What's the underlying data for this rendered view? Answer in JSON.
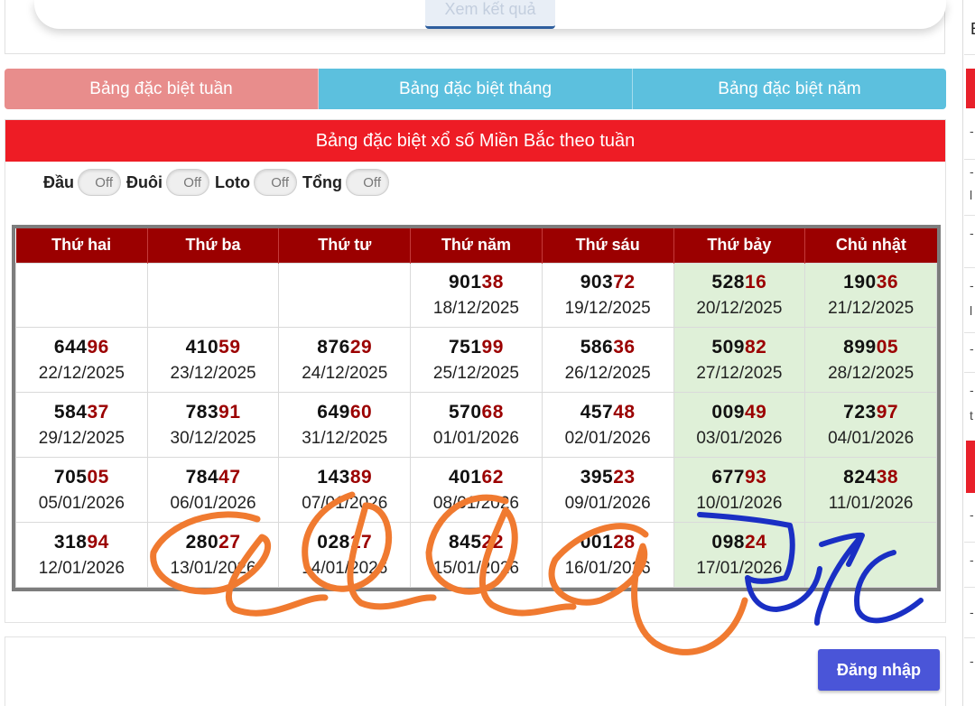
{
  "top": {
    "view_button": "Xem kết quả"
  },
  "tabs": [
    {
      "label": "Bảng đặc biệt tuần",
      "active": true
    },
    {
      "label": "Bảng đặc biệt tháng",
      "active": false
    },
    {
      "label": "Bảng đặc biệt năm",
      "active": false
    }
  ],
  "panel": {
    "title": "Bảng đặc biệt xổ số Miền Bắc theo tuần"
  },
  "toggles": [
    {
      "label": "Đầu",
      "state": "Off"
    },
    {
      "label": "Đuôi",
      "state": "Off"
    },
    {
      "label": "Loto",
      "state": "Off"
    },
    {
      "label": "Tổng",
      "state": "Off"
    }
  ],
  "table": {
    "headers": [
      "Thứ hai",
      "Thứ ba",
      "Thứ tư",
      "Thứ năm",
      "Thứ sáu",
      "Thứ bảy",
      "Chủ nhật"
    ],
    "rows": [
      [
        null,
        null,
        null,
        {
          "prefix": "901",
          "tail": "38",
          "date": "18/12/2025"
        },
        {
          "prefix": "903",
          "tail": "72",
          "date": "19/12/2025"
        },
        {
          "prefix": "528",
          "tail": "16",
          "date": "20/12/2025"
        },
        {
          "prefix": "190",
          "tail": "36",
          "date": "21/12/2025"
        }
      ],
      [
        {
          "prefix": "644",
          "tail": "96",
          "date": "22/12/2025"
        },
        {
          "prefix": "410",
          "tail": "59",
          "date": "23/12/2025"
        },
        {
          "prefix": "876",
          "tail": "29",
          "date": "24/12/2025"
        },
        {
          "prefix": "751",
          "tail": "99",
          "date": "25/12/2025"
        },
        {
          "prefix": "586",
          "tail": "36",
          "date": "26/12/2025"
        },
        {
          "prefix": "509",
          "tail": "82",
          "date": "27/12/2025"
        },
        {
          "prefix": "899",
          "tail": "05",
          "date": "28/12/2025"
        }
      ],
      [
        {
          "prefix": "584",
          "tail": "37",
          "date": "29/12/2025"
        },
        {
          "prefix": "783",
          "tail": "91",
          "date": "30/12/2025"
        },
        {
          "prefix": "649",
          "tail": "60",
          "date": "31/12/2025"
        },
        {
          "prefix": "570",
          "tail": "68",
          "date": "01/01/2026"
        },
        {
          "prefix": "457",
          "tail": "48",
          "date": "02/01/2026"
        },
        {
          "prefix": "009",
          "tail": "49",
          "date": "03/01/2026"
        },
        {
          "prefix": "723",
          "tail": "97",
          "date": "04/01/2026"
        }
      ],
      [
        {
          "prefix": "705",
          "tail": "05",
          "date": "05/01/2026"
        },
        {
          "prefix": "784",
          "tail": "47",
          "date": "06/01/2026"
        },
        {
          "prefix": "143",
          "tail": "89",
          "date": "07/01/2026"
        },
        {
          "prefix": "401",
          "tail": "62",
          "date": "08/01/2026"
        },
        {
          "prefix": "395",
          "tail": "23",
          "date": "09/01/2026"
        },
        {
          "prefix": "677",
          "tail": "93",
          "date": "10/01/2026"
        },
        {
          "prefix": "824",
          "tail": "38",
          "date": "11/01/2026"
        }
      ],
      [
        {
          "prefix": "318",
          "tail": "94",
          "date": "12/01/2026"
        },
        {
          "prefix": "280",
          "tail": "27",
          "date": "13/01/2026"
        },
        {
          "prefix": "028",
          "tail": "17",
          "date": "14/01/2026"
        },
        {
          "prefix": "845",
          "tail": "22",
          "date": "15/01/2026"
        },
        {
          "prefix": "001",
          "tail": "28",
          "date": "16/01/2026"
        },
        {
          "prefix": "098",
          "tail": "24",
          "date": "17/01/2026"
        },
        null
      ]
    ]
  },
  "login_button": "Đăng nhập",
  "colors": {
    "tab_active": "#e88d8c",
    "tab_inactive": "#5cc0de",
    "title_red": "#ee1c25",
    "header_dark_red": "#9b0000",
    "weekend_green": "#dff0d8",
    "login_blue": "#4a55d8",
    "annotation_orange": "#f07a30",
    "annotation_blue": "#1a2fc4"
  }
}
